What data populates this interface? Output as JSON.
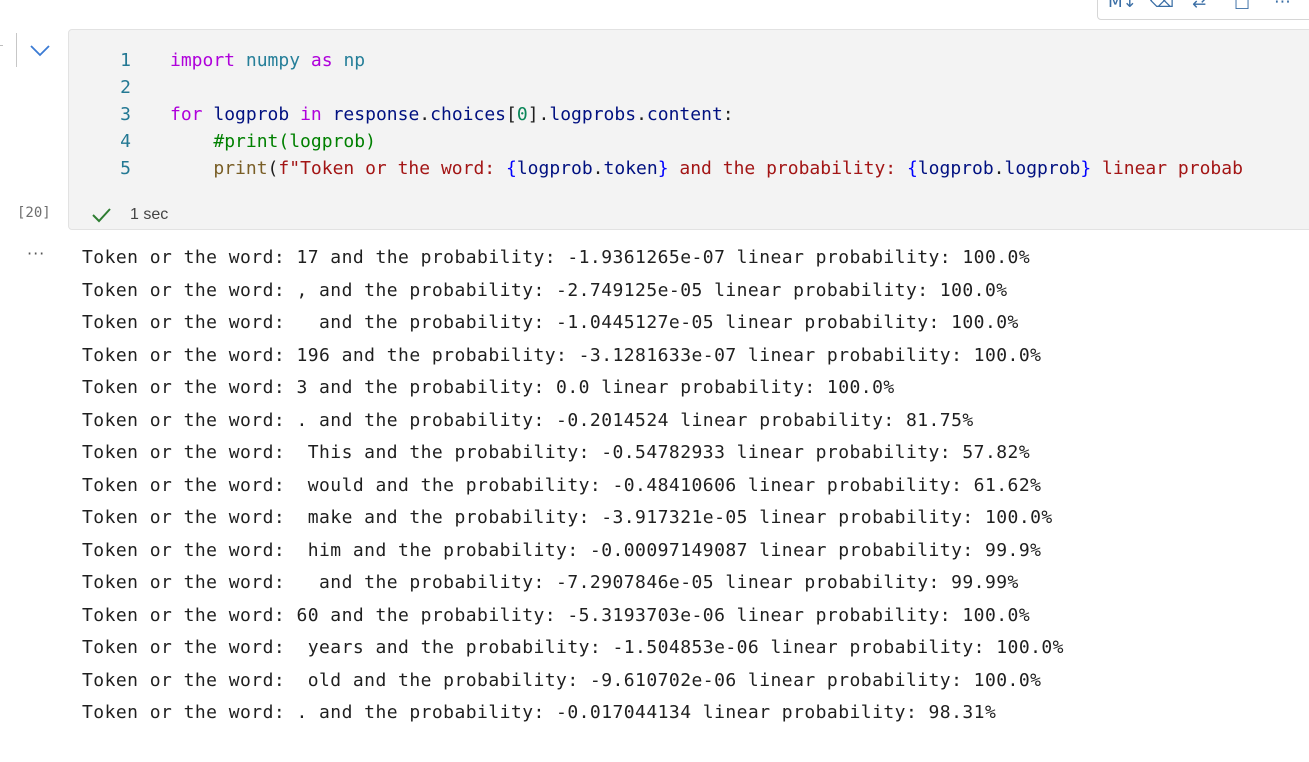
{
  "toolbar": {
    "buttons": [
      {
        "name": "markdown",
        "label": "M↓"
      },
      {
        "name": "clear-output",
        "label": "⌫"
      },
      {
        "name": "split",
        "label": "⇄"
      },
      {
        "name": "square",
        "label": "□"
      },
      {
        "name": "more",
        "label": "⋯"
      }
    ]
  },
  "cell": {
    "execution_count": "[20]",
    "status": {
      "duration": "1 sec",
      "state": "success"
    },
    "code": {
      "line_numbers": [
        "1",
        "2",
        "3",
        "4",
        "5"
      ],
      "lines": [
        [
          {
            "t": "import",
            "c": "kw"
          },
          {
            "t": " ",
            "c": "plain"
          },
          {
            "t": "numpy",
            "c": "mod"
          },
          {
            "t": " ",
            "c": "plain"
          },
          {
            "t": "as",
            "c": "kw"
          },
          {
            "t": " ",
            "c": "plain"
          },
          {
            "t": "np",
            "c": "mod"
          }
        ],
        [],
        [
          {
            "t": "for",
            "c": "kw"
          },
          {
            "t": " ",
            "c": "plain"
          },
          {
            "t": "logprob",
            "c": "var"
          },
          {
            "t": " ",
            "c": "plain"
          },
          {
            "t": "in",
            "c": "kw"
          },
          {
            "t": " ",
            "c": "plain"
          },
          {
            "t": "response",
            "c": "var"
          },
          {
            "t": ".",
            "c": "plain"
          },
          {
            "t": "choices",
            "c": "var"
          },
          {
            "t": "[",
            "c": "plain"
          },
          {
            "t": "0",
            "c": "num"
          },
          {
            "t": "].",
            "c": "plain"
          },
          {
            "t": "logprobs",
            "c": "var"
          },
          {
            "t": ".",
            "c": "plain"
          },
          {
            "t": "content",
            "c": "var"
          },
          {
            "t": ":",
            "c": "plain"
          }
        ],
        [
          {
            "t": "    ",
            "c": "plain"
          },
          {
            "t": "#print(logprob)",
            "c": "cmt"
          }
        ],
        [
          {
            "t": "    ",
            "c": "plain"
          },
          {
            "t": "print",
            "c": "fn"
          },
          {
            "t": "(",
            "c": "plain"
          },
          {
            "t": "f\"Token or the word: ",
            "c": "str"
          },
          {
            "t": "{",
            "c": "brk"
          },
          {
            "t": "logprob",
            "c": "var"
          },
          {
            "t": ".",
            "c": "plain"
          },
          {
            "t": "token",
            "c": "var"
          },
          {
            "t": "}",
            "c": "brk"
          },
          {
            "t": " and the probability: ",
            "c": "str"
          },
          {
            "t": "{",
            "c": "brk"
          },
          {
            "t": "logprob",
            "c": "var"
          },
          {
            "t": ".",
            "c": "plain"
          },
          {
            "t": "logprob",
            "c": "var"
          },
          {
            "t": "}",
            "c": "brk"
          },
          {
            "t": " linear probab",
            "c": "str"
          }
        ]
      ]
    }
  },
  "output": {
    "ellipsis": "···",
    "lines": [
      "Token or the word: 17 and the probability: -1.9361265e-07 linear probability: 100.0%",
      "Token or the word: , and the probability: -2.749125e-05 linear probability: 100.0%",
      "Token or the word:   and the probability: -1.0445127e-05 linear probability: 100.0%",
      "Token or the word: 196 and the probability: -3.1281633e-07 linear probability: 100.0%",
      "Token or the word: 3 and the probability: 0.0 linear probability: 100.0%",
      "Token or the word: . and the probability: -0.2014524 linear probability: 81.75%",
      "Token or the word:  This and the probability: -0.54782933 linear probability: 57.82%",
      "Token or the word:  would and the probability: -0.48410606 linear probability: 61.62%",
      "Token or the word:  make and the probability: -3.917321e-05 linear probability: 100.0%",
      "Token or the word:  him and the probability: -0.00097149087 linear probability: 99.9%",
      "Token or the word:   and the probability: -7.2907846e-05 linear probability: 99.99%",
      "Token or the word: 60 and the probability: -5.3193703e-06 linear probability: 100.0%",
      "Token or the word:  years and the probability: -1.504853e-06 linear probability: 100.0%",
      "Token or the word:  old and the probability: -9.610702e-06 linear probability: 100.0%",
      "Token or the word: . and the probability: -0.017044134 linear probability: 98.31%"
    ]
  }
}
